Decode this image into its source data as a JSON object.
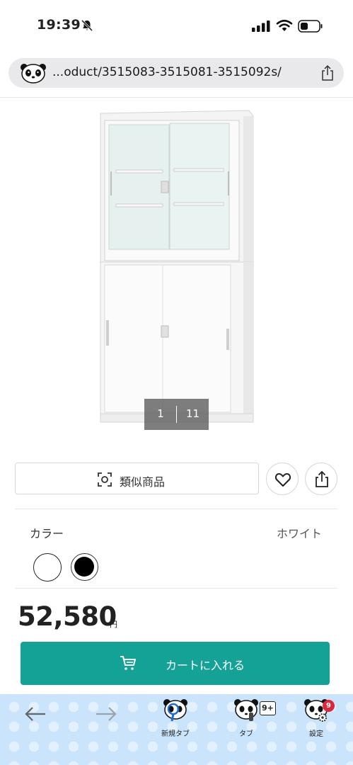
{
  "status_bar": {
    "time": "19:39"
  },
  "browser": {
    "url": "...oduct/3515083-3515081-3515092s/"
  },
  "gallery": {
    "current": "1",
    "total": "11"
  },
  "actions": {
    "similar_label": "類似商品"
  },
  "color": {
    "label": "カラー",
    "value": "ホワイト",
    "swatches": [
      "#ffffff",
      "#000000"
    ]
  },
  "price": {
    "amount": "52,580",
    "unit": "円"
  },
  "cart": {
    "label": "カートに入れる",
    "color": "#14a196"
  },
  "toolbar": {
    "new_tab_label": "新規タブ",
    "tabs_label": "タブ",
    "tab_count": "9+",
    "settings_label": "設定",
    "settings_badge": "9"
  }
}
